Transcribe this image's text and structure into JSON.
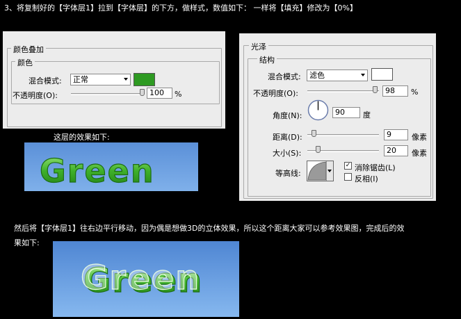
{
  "intro_text": "3、将复制好的【字体层1】拉到【字体层】的下方，做样式，数值如下： 一样将【填充】修改为【0%】",
  "panel_left": {
    "title": "颜色叠加",
    "group": "颜色",
    "blend_label": "混合模式:",
    "blend_value": "正常",
    "swatch_color": "#2e9a22",
    "opacity_label": "不透明度(O):",
    "opacity_value": "100",
    "opacity_unit": "%",
    "opacity_level": 1.0
  },
  "panel_right": {
    "title": "光泽",
    "group": "结构",
    "blend_label": "混合模式:",
    "blend_value": "滤色",
    "swatch_color": "#ffffff",
    "opacity_label": "不透明度(O):",
    "opacity_value": "98",
    "opacity_unit": "%",
    "opacity_level": 0.98,
    "angle_label": "角度(N):",
    "angle_value": "90",
    "angle_unit": "度",
    "distance_label": "距离(D):",
    "distance_value": "9",
    "distance_unit": "像素",
    "size_label": "大小(S):",
    "size_value": "20",
    "size_unit": "像素",
    "contour_label": "等高线:",
    "antialias_label": "消除锯齿(L)",
    "antialias_checked": "✓",
    "invert_label": "反相(I)"
  },
  "caption_layer": "这层的效果如下:",
  "image1_text": "Green",
  "bottom_text_line1": "然后将【字体层1】往右边平行移动，因为偶是想做3D的立体效果，所以这个距离大家可以参考效果图，完成后的效",
  "bottom_text_line2": "果如下:",
  "image2_text": "Green"
}
